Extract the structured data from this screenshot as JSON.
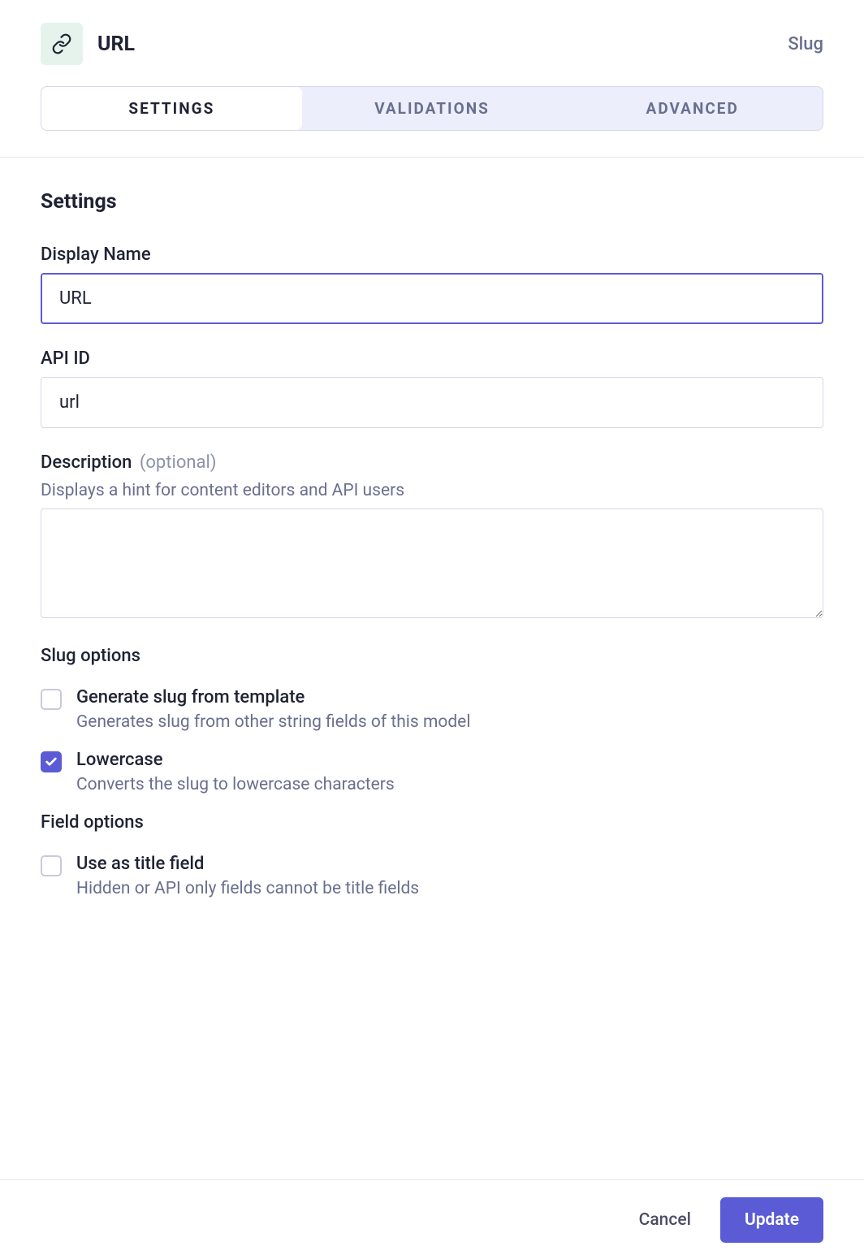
{
  "header": {
    "title": "URL",
    "right_label": "Slug"
  },
  "tabs": [
    {
      "label": "Settings",
      "active": true
    },
    {
      "label": "Validations",
      "active": false
    },
    {
      "label": "Advanced",
      "active": false
    }
  ],
  "section": {
    "title": "Settings",
    "display_name": {
      "label": "Display Name",
      "value": "URL"
    },
    "api_id": {
      "label": "API ID",
      "value": "url"
    },
    "description": {
      "label": "Description",
      "optional": "(optional)",
      "hint": "Displays a hint for content editors and API users",
      "value": ""
    },
    "slug_options": {
      "heading": "Slug options",
      "items": [
        {
          "label": "Generate slug from template",
          "desc": "Generates slug from other string fields of this model",
          "checked": false
        },
        {
          "label": "Lowercase",
          "desc": "Converts the slug to lowercase characters",
          "checked": true
        }
      ]
    },
    "field_options": {
      "heading": "Field options",
      "items": [
        {
          "label": "Use as title field",
          "desc": "Hidden or API only fields cannot be title fields",
          "checked": false
        }
      ]
    }
  },
  "footer": {
    "cancel": "Cancel",
    "update": "Update"
  }
}
